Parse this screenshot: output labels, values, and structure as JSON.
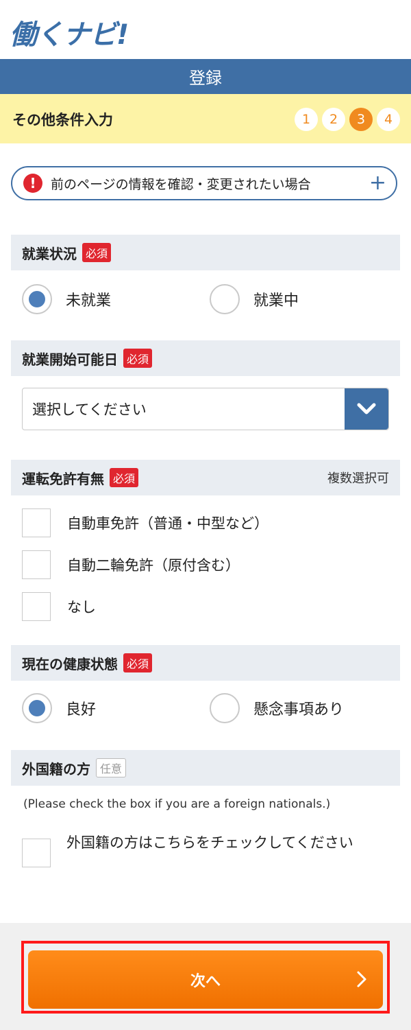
{
  "app": {
    "logo": "働くナビ!"
  },
  "header": {
    "title": "登録"
  },
  "step_bar": {
    "title": "その他条件入力",
    "steps": [
      "1",
      "2",
      "3",
      "4"
    ],
    "current_step": 3
  },
  "notice": {
    "icon": "!",
    "text": "前のページの情報を確認・変更されたい場合",
    "expand": "+"
  },
  "employment": {
    "title": "就業状況",
    "required": "必須",
    "options": [
      "未就業",
      "就業中"
    ],
    "selected": "未就業"
  },
  "start_date": {
    "title": "就業開始可能日",
    "required": "必須",
    "select_value": "選択してください"
  },
  "license": {
    "title": "運転免許有無",
    "required": "必須",
    "note": "複数選択可",
    "options": [
      "自動車免許（普通・中型など）",
      "自動二輪免許（原付含む）",
      "なし"
    ]
  },
  "health": {
    "title": "現在の健康状態",
    "required": "必須",
    "options": [
      "良好",
      "懸念事項あり"
    ],
    "selected": "良好"
  },
  "foreign": {
    "title": "外国籍の方",
    "optional": "任意",
    "note": "(Please check the box if you are a foreign nationals.)",
    "checkbox_label": "外国籍の方はこちらをチェックしてください"
  },
  "footer": {
    "next_label": "次へ"
  },
  "colors": {
    "brand": "#3f6fa5",
    "accent": "#f08a1f",
    "required": "#e0262f",
    "highlight": "#ff1a1a"
  }
}
